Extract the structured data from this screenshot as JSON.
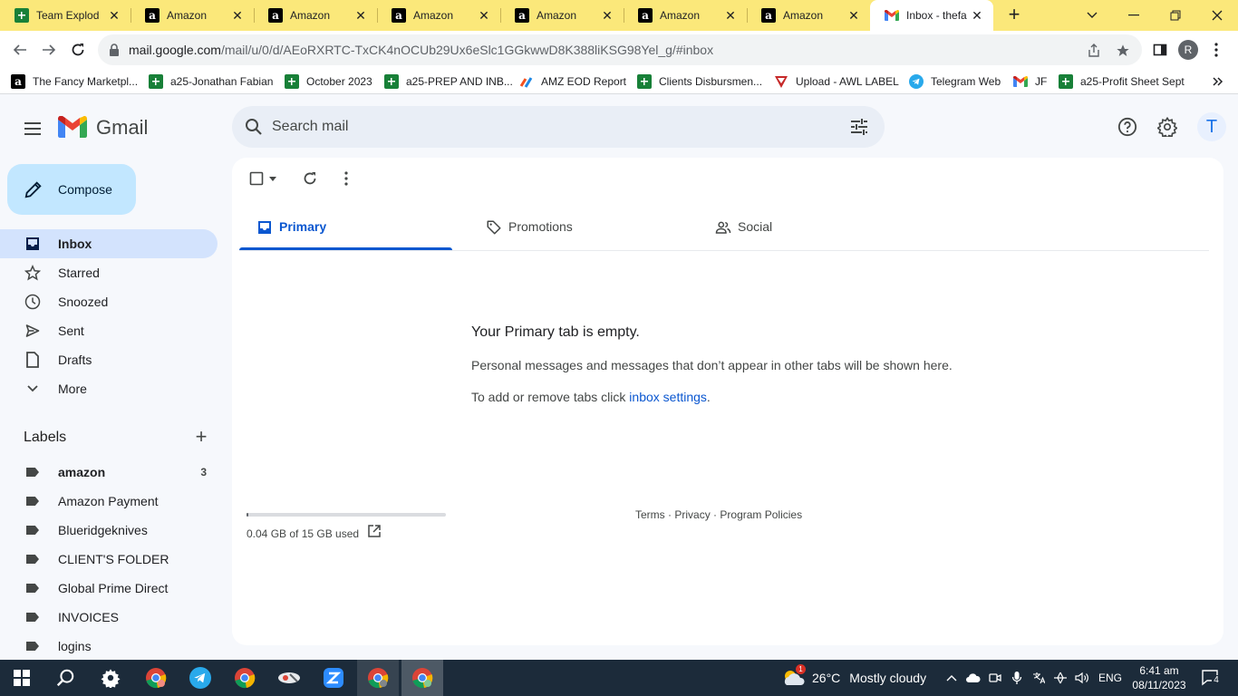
{
  "browser": {
    "tabs": [
      {
        "title": "Team Explod",
        "favicon": "sheets-icon"
      },
      {
        "title": "Amazon",
        "favicon": "amazon-icon"
      },
      {
        "title": "Amazon",
        "favicon": "amazon-icon"
      },
      {
        "title": "Amazon",
        "favicon": "amazon-icon"
      },
      {
        "title": "Amazon",
        "favicon": "amazon-icon"
      },
      {
        "title": "Amazon",
        "favicon": "amazon-icon"
      },
      {
        "title": "Amazon",
        "favicon": "amazon-icon"
      },
      {
        "title": "Inbox - thefa",
        "favicon": "gmail-icon",
        "active": true
      }
    ],
    "url_host": "mail.google.com",
    "url_path": "/mail/u/0/d/AEoRXRTC-TxCK4nOCUb29Ux6eSlc1GGkwwD8K388liKSG98Yel_g/#inbox",
    "profile_initial": "R",
    "bookmarks": [
      {
        "label": "The Fancy Marketpl...",
        "icon": "amazon-icon"
      },
      {
        "label": "a25-Jonathan Fabian",
        "icon": "sheets-icon"
      },
      {
        "label": "October 2023",
        "icon": "sheets-icon"
      },
      {
        "label": "a25-PREP AND INB...",
        "icon": "sheets-icon"
      },
      {
        "label": "AMZ EOD Report",
        "icon": "report-icon"
      },
      {
        "label": "Clients Disbursmen...",
        "icon": "sheets-icon"
      },
      {
        "label": "Upload - AWL LABEL",
        "icon": "upload-icon"
      },
      {
        "label": "Telegram Web",
        "icon": "telegram-icon"
      },
      {
        "label": "JF",
        "icon": "gmail-icon"
      },
      {
        "label": "a25-Profit Sheet Sept",
        "icon": "sheets-icon"
      }
    ]
  },
  "gmail": {
    "product_name": "Gmail",
    "search_placeholder": "Search mail",
    "avatar_initial": "T",
    "compose_label": "Compose",
    "nav": [
      {
        "label": "Inbox",
        "icon": "inbox-icon",
        "active": true
      },
      {
        "label": "Starred",
        "icon": "star-icon"
      },
      {
        "label": "Snoozed",
        "icon": "clock-icon"
      },
      {
        "label": "Sent",
        "icon": "send-icon"
      },
      {
        "label": "Drafts",
        "icon": "draft-icon"
      },
      {
        "label": "More",
        "icon": "chevron-down-icon"
      }
    ],
    "labels_title": "Labels",
    "labels": [
      {
        "label": "amazon",
        "count": "3",
        "bold": true
      },
      {
        "label": "Amazon Payment",
        "count": ""
      },
      {
        "label": "Blueridgeknives",
        "count": ""
      },
      {
        "label": "CLIENT'S FOLDER",
        "count": ""
      },
      {
        "label": "Global Prime Direct",
        "count": ""
      },
      {
        "label": "INVOICES",
        "count": ""
      },
      {
        "label": "logins",
        "count": ""
      }
    ],
    "category_tabs": [
      {
        "label": "Primary",
        "icon": "inbox-tab-icon",
        "active": true
      },
      {
        "label": "Promotions",
        "icon": "tag-icon"
      },
      {
        "label": "Social",
        "icon": "people-icon"
      }
    ],
    "empty_state": {
      "title": "Your Primary tab is empty.",
      "body": "Personal messages and messages that don’t appear in other tabs will be shown here.",
      "help_prefix": "To add or remove tabs click ",
      "help_link": "inbox settings",
      "help_suffix": "."
    },
    "storage": {
      "text": "0.04 GB of 15 GB used",
      "used_fraction": 0.003
    },
    "footer": {
      "terms": "Terms",
      "privacy": "Privacy",
      "policies": "Program Policies",
      "separator": "·"
    }
  },
  "taskbar": {
    "weather_temp": "26°C",
    "weather_desc": "Mostly cloudy",
    "weather_badge": "1",
    "language": "ENG",
    "time": "6:41 am",
    "date": "08/11/2023",
    "notifications": "4"
  }
}
